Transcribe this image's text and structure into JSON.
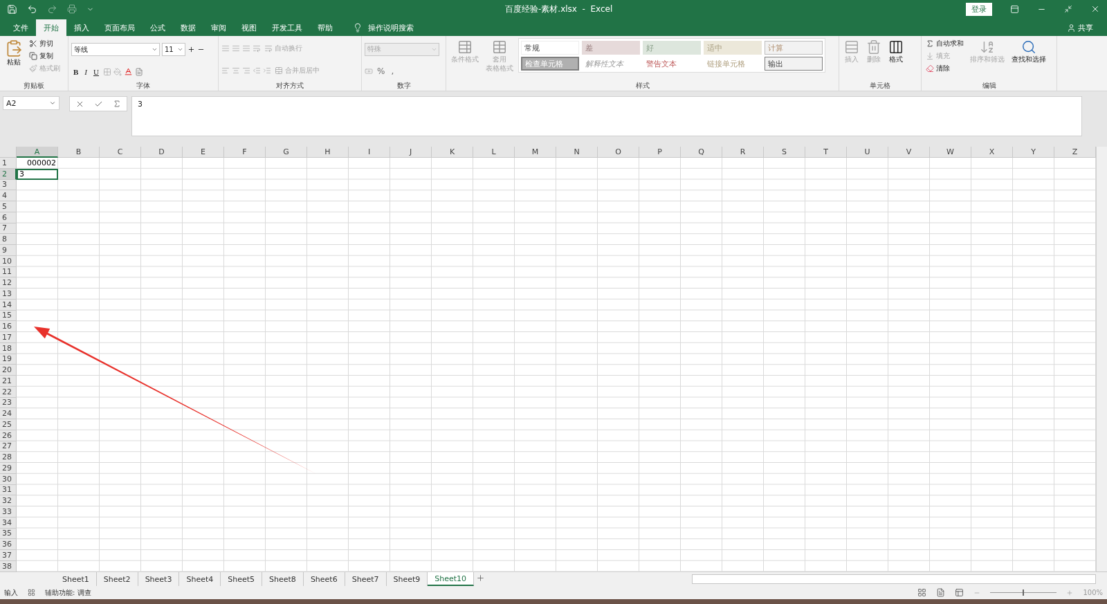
{
  "window": {
    "title": "百度经验-素材.xlsx  -  Excel",
    "login": "登录"
  },
  "menu_tabs": [
    {
      "label": "文件",
      "selected": false
    },
    {
      "label": "开始",
      "selected": true
    },
    {
      "label": "插入",
      "selected": false
    },
    {
      "label": "页面布局",
      "selected": false
    },
    {
      "label": "公式",
      "selected": false
    },
    {
      "label": "数据",
      "selected": false
    },
    {
      "label": "审阅",
      "selected": false
    },
    {
      "label": "视图",
      "selected": false
    },
    {
      "label": "开发工具",
      "selected": false
    },
    {
      "label": "帮助",
      "selected": false
    }
  ],
  "tell_me": "操作说明搜索",
  "share": "共享",
  "ribbon": {
    "clipboard": {
      "title": "剪贴板",
      "paste": "粘贴",
      "items": [
        {
          "label": "剪切",
          "disabled": false
        },
        {
          "label": "复制",
          "disabled": false
        },
        {
          "label": "格式刷",
          "disabled": true
        }
      ]
    },
    "font": {
      "title": "字体",
      "font_name": "等线",
      "font_size": "11",
      "styles": [
        "B",
        "I",
        "U"
      ]
    },
    "alignment": {
      "title": "对齐方式",
      "items": [
        {
          "label": "自动换行",
          "disabled": true
        },
        {
          "label": "合并后居中",
          "disabled": true
        }
      ]
    },
    "number": {
      "title": "数字",
      "format": "特殊",
      "symbols": [
        "%",
        ","
      ]
    },
    "styles": {
      "title": "样式",
      "buttons": [
        {
          "lines": [
            "条件格式"
          ]
        },
        {
          "lines": [
            "套用",
            "表格格式"
          ]
        }
      ],
      "cells": [
        {
          "label": "常规",
          "kind": "normal"
        },
        {
          "label": "差",
          "kind": "bad"
        },
        {
          "label": "好",
          "kind": "good"
        },
        {
          "label": "适中",
          "kind": "neutral"
        },
        {
          "label": "计算",
          "kind": "calculation"
        },
        {
          "label": "检查单元格",
          "kind": "check"
        },
        {
          "label": "解释性文本",
          "kind": "explanatory"
        },
        {
          "label": "警告文本",
          "kind": "warning"
        },
        {
          "label": "链接单元格",
          "kind": "linked"
        },
        {
          "label": "输出",
          "kind": "output"
        }
      ]
    },
    "cells": {
      "title": "单元格",
      "items": [
        {
          "label": "插入",
          "disabled": true
        },
        {
          "label": "删除",
          "disabled": true
        },
        {
          "label": "格式",
          "disabled": false
        }
      ]
    },
    "editing": {
      "title": "编辑",
      "items": [
        {
          "label": "自动求和",
          "disabled": false
        },
        {
          "label": "填充",
          "disabled": true
        },
        {
          "label": "清除",
          "disabled": false
        }
      ],
      "big": [
        {
          "label": "排序和筛选",
          "disabled": true
        },
        {
          "label": "查找和选择",
          "disabled": false
        }
      ]
    }
  },
  "formula_bar": {
    "name_box": "A2",
    "formula": "3"
  },
  "sheet": {
    "columns": [
      "A",
      "B",
      "C",
      "D",
      "E",
      "F",
      "G",
      "H",
      "I",
      "J",
      "K",
      "L",
      "M",
      "N",
      "O",
      "P",
      "Q",
      "R",
      "S",
      "T",
      "U",
      "V",
      "W",
      "X",
      "Y",
      "Z"
    ],
    "rows": [
      {
        "header": "1",
        "cells": [
          {
            "value": "000002",
            "kind": "number",
            "selected": false
          }
        ]
      },
      {
        "header": "2",
        "cells": [
          {
            "value": "3",
            "kind": "text",
            "selected": true
          }
        ]
      },
      {
        "header": "3"
      },
      {
        "header": "4"
      },
      {
        "header": "5"
      },
      {
        "header": "6"
      },
      {
        "header": "7"
      },
      {
        "header": "8"
      },
      {
        "header": "9"
      },
      {
        "header": "10"
      },
      {
        "header": "11"
      },
      {
        "header": "12"
      },
      {
        "header": "13"
      },
      {
        "header": "14"
      },
      {
        "header": "15"
      },
      {
        "header": "16"
      },
      {
        "header": "17"
      },
      {
        "header": "18"
      },
      {
        "header": "19"
      },
      {
        "header": "20"
      },
      {
        "header": "21"
      },
      {
        "header": "22"
      },
      {
        "header": "23"
      },
      {
        "header": "24"
      },
      {
        "header": "25"
      },
      {
        "header": "26"
      },
      {
        "header": "27"
      },
      {
        "header": "28"
      },
      {
        "header": "29"
      },
      {
        "header": "30"
      },
      {
        "header": "31"
      },
      {
        "header": "32"
      },
      {
        "header": "33"
      },
      {
        "header": "34"
      },
      {
        "header": "35"
      },
      {
        "header": "36"
      },
      {
        "header": "37"
      },
      {
        "header": "38"
      }
    ]
  },
  "sheet_tabs": [
    {
      "label": "Sheet1",
      "selected": false
    },
    {
      "label": "Sheet2",
      "selected": false
    },
    {
      "label": "Sheet3",
      "selected": false
    },
    {
      "label": "Sheet4",
      "selected": false
    },
    {
      "label": "Sheet5",
      "selected": false
    },
    {
      "label": "Sheet8",
      "selected": false
    },
    {
      "label": "Sheet6",
      "selected": false
    },
    {
      "label": "Sheet7",
      "selected": false
    },
    {
      "label": "Sheet9",
      "selected": false
    },
    {
      "label": "Sheet10",
      "selected": true
    }
  ],
  "status_bar": {
    "mode": "输入",
    "accessibility": "辅助功能: 调查",
    "zoom": {
      "level": 0.5,
      "reading": "100%"
    }
  }
}
